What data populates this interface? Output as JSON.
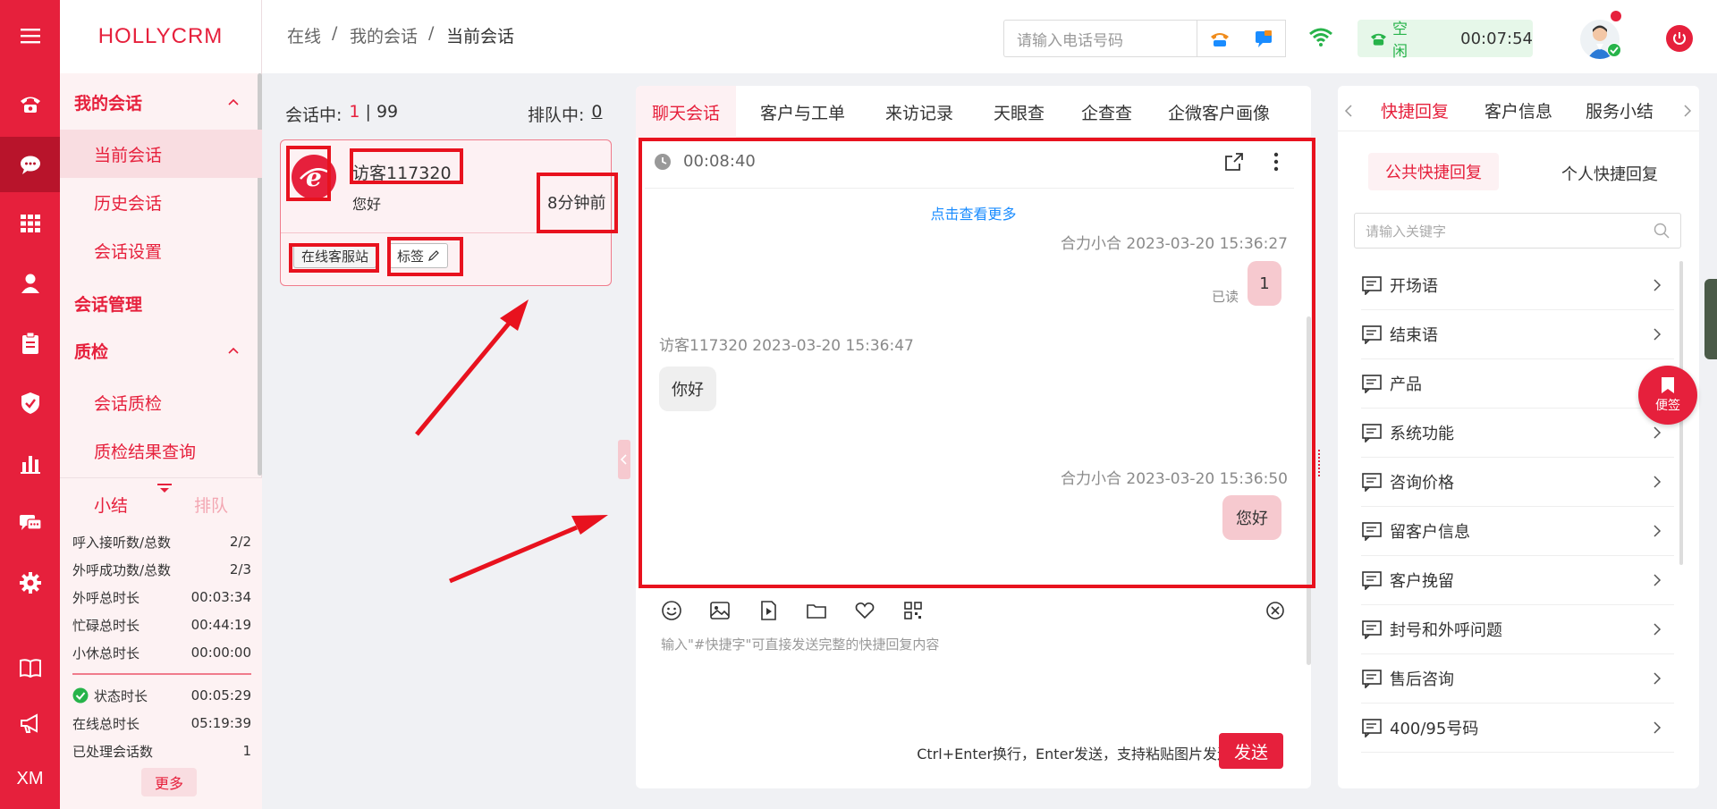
{
  "app": {
    "brand": "HOLLYCRM"
  },
  "rail": {
    "bottom_text": "XM"
  },
  "subnav": {
    "groups": [
      {
        "label": "我的会话",
        "items": [
          "当前会话",
          "历史会话",
          "会话设置"
        ]
      },
      {
        "label": "会话管理"
      },
      {
        "label": "质检",
        "items": [
          "会话质检",
          "质检结果查询"
        ]
      }
    ],
    "summary_tabs": [
      "小结",
      "排队"
    ],
    "stats": [
      {
        "label": "呼入接听数/总数",
        "value": "2/2"
      },
      {
        "label": "外呼成功数/总数",
        "value": "2/3"
      },
      {
        "label": "外呼总时长",
        "value": "00:03:34"
      },
      {
        "label": "忙碌总时长",
        "value": "00:44:19"
      },
      {
        "label": "小休总时长",
        "value": "00:00:00"
      }
    ],
    "stats2": [
      {
        "label": "状态时长",
        "value": "00:05:29"
      },
      {
        "label": "在线总时长",
        "value": "05:19:39"
      },
      {
        "label": "已处理会话数",
        "value": "1"
      }
    ],
    "more_label": "更多"
  },
  "topbar": {
    "breadcrumb": [
      "在线",
      "/",
      "我的会话",
      "/",
      "当前会话"
    ],
    "phone_placeholder": "请输入电话号码",
    "status_label": "空闲",
    "status_time": "00:07:54"
  },
  "sessions": {
    "active_label": "会话中:",
    "active_count": "1",
    "active_max": "| 99",
    "queue_label": "排队中:",
    "queue_count": "0",
    "card": {
      "visitor": "访客117320",
      "last_msg": "您好",
      "time_ago": "8分钟前",
      "source_tag": "在线客服站",
      "tag_label": "标签"
    }
  },
  "chat": {
    "tabs": [
      "聊天会话",
      "客户与工单",
      "来访记录",
      "天眼查",
      "企查查",
      "企微客户画像"
    ],
    "timer": "00:08:40",
    "load_more": "点击查看更多",
    "messages": [
      {
        "side": "right",
        "meta": "合力小合 2023-03-20 15:36:27",
        "text": "1",
        "read": "已读"
      },
      {
        "side": "left",
        "meta": "访客117320 2023-03-20 15:36:47",
        "text": "你好"
      },
      {
        "side": "right",
        "meta": "合力小合 2023-03-20 15:36:50",
        "text": "您好"
      }
    ],
    "input_placeholder": "输入\"#快捷字\"可直接发送完整的快捷回复内容",
    "hint": "Ctrl+Enter换行，Enter发送，支持粘贴图片发送",
    "send_label": "发送"
  },
  "quick": {
    "tabs": [
      "快捷回复",
      "客户信息",
      "服务小结"
    ],
    "subtabs": [
      "公共快捷回复",
      "个人快捷回复"
    ],
    "search_placeholder": "请输入关键字",
    "items": [
      "开场语",
      "结束语",
      "产品",
      "系统功能",
      "咨询价格",
      "留客户信息",
      "客户挽留",
      "封号和外呼问题",
      "售后咨询",
      "400/95号码"
    ],
    "sticky_label": "便签"
  },
  "colors": {
    "brand": "#e6203c",
    "annotation": "#e8121e",
    "link": "#1a8cff",
    "status_green": "#27b34a"
  }
}
